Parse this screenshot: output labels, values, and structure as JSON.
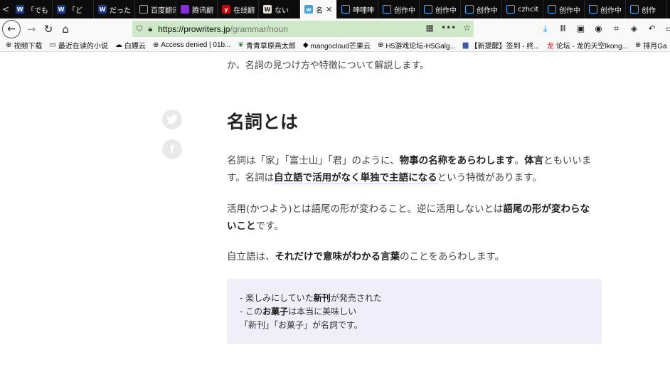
{
  "tabs": [
    {
      "icon": "scroll-left",
      "label": "<"
    },
    {
      "label": "「でも",
      "icon_text": "W"
    },
    {
      "label": "「ど",
      "icon_text": "W"
    },
    {
      "label": "だった",
      "icon_text": "W"
    },
    {
      "label": "百度翻译"
    },
    {
      "label": "腾讯翻"
    },
    {
      "label": "在线翻"
    },
    {
      "label": "ない",
      "icon_text": "W"
    },
    {
      "label": "名",
      "active": true
    },
    {
      "label": "呻哩呻"
    },
    {
      "label": "创作中"
    },
    {
      "label": "创作中"
    },
    {
      "label": "创作中"
    },
    {
      "label": "czhcit"
    },
    {
      "label": "创作中"
    },
    {
      "label": "创作中"
    },
    {
      "label": "创作"
    }
  ],
  "navbar": {
    "url_host": "https://prowriters.jp",
    "url_path": "/grammar/noun"
  },
  "bookmarks": [
    "视频下载",
    "最近在读的小说",
    "白嫖云",
    "Access denied | 01b...",
    "青青草原燕太郎",
    "mangocloud芒果云",
    "H5游戏论坛-H5Galg...",
    "【新提醒】签到 - 终...",
    "论坛 - 龙的天空lkong...",
    "排月Ga"
  ],
  "article": {
    "intro": "か、名詞の見つけ方や特徴について解説します。",
    "heading": "名詞とは",
    "p1": {
      "a": "名詞は「家」「富士山」「君」のように、",
      "b": "物事の名称をあらわします",
      "c": "。",
      "d": "体言",
      "e": "ともいいます。名詞は",
      "f": "自立語で活用がなく単独で主語になる",
      "g": "という特徴があります。"
    },
    "p2": {
      "a": "活用(かつよう)とは語尾の形が変わること。逆に活用しないとは",
      "b": "語尾の形が変わらないこと",
      "c": "です。"
    },
    "p3": {
      "a": "自立語は、",
      "b": "それだけで意味がわかる言葉",
      "c": "のことをあらわします。"
    },
    "examples": {
      "l1a": "- 楽しみにしていた",
      "l1b": "新刊",
      "l1c": "が発売された",
      "l2a": "- この",
      "l2b": "お菓子",
      "l2c": "は本当に美味しい",
      "l3": "「新刊」「お菓子」が名詞です。"
    }
  }
}
